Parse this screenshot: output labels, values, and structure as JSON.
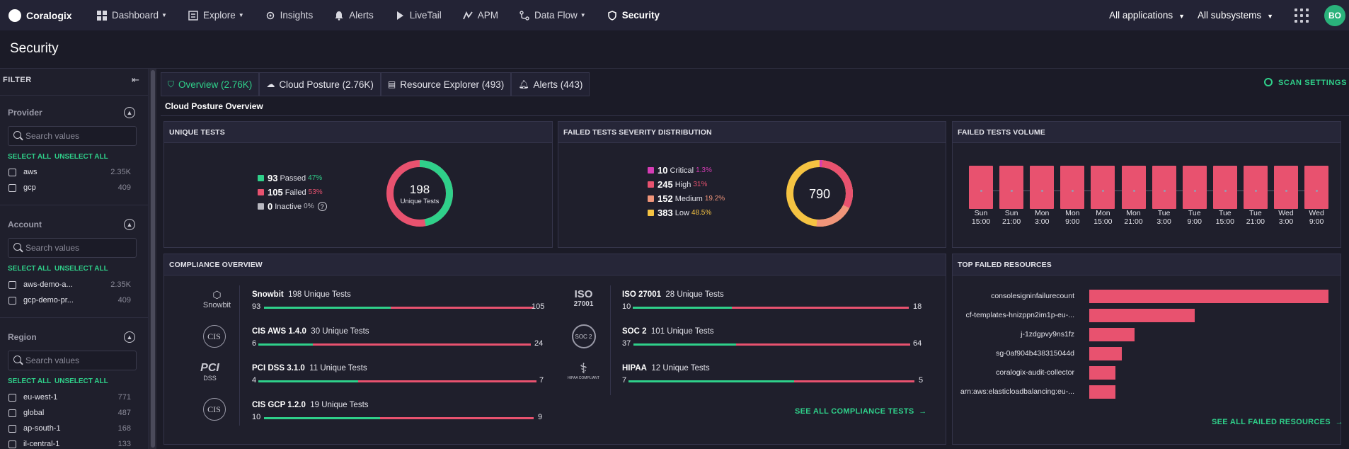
{
  "topnav": {
    "logo_text": "Coralogix",
    "items": [
      {
        "label": "Dashboard",
        "icon": "dashboard-icon",
        "dropdown": true
      },
      {
        "label": "Explore",
        "icon": "explore-icon",
        "dropdown": true
      },
      {
        "label": "Insights",
        "icon": "insights-icon",
        "dropdown": false
      },
      {
        "label": "Alerts",
        "icon": "bell-icon",
        "dropdown": false
      },
      {
        "label": "LiveTail",
        "icon": "play-icon",
        "dropdown": false
      },
      {
        "label": "APM",
        "icon": "apm-icon",
        "dropdown": false
      },
      {
        "label": "Data Flow",
        "icon": "data-flow-icon",
        "dropdown": true
      },
      {
        "label": "Security",
        "icon": "shield-icon",
        "dropdown": false,
        "active": true
      }
    ],
    "apps_select": "All applications",
    "subsystems_select": "All subsystems",
    "avatar": "BO"
  },
  "page_title": "Security",
  "sidebar": {
    "filter_label": "FILTER",
    "select_all": "SELECT ALL",
    "unselect_all": "UNSELECT ALL",
    "search_placeholder": "Search values",
    "sections": [
      {
        "title": "Provider",
        "rows": [
          {
            "label": "aws",
            "count": "2.35K"
          },
          {
            "label": "gcp",
            "count": "409"
          }
        ]
      },
      {
        "title": "Account",
        "rows": [
          {
            "label": "aws-demo-a...",
            "count": "2.35K"
          },
          {
            "label": "gcp-demo-pr...",
            "count": "409"
          }
        ]
      },
      {
        "title": "Region",
        "rows": [
          {
            "label": "eu-west-1",
            "count": "771"
          },
          {
            "label": "global",
            "count": "487"
          },
          {
            "label": "ap-south-1",
            "count": "168"
          },
          {
            "label": "il-central-1",
            "count": "133"
          }
        ]
      }
    ]
  },
  "tabs": [
    {
      "label": "Overview (2.76K)",
      "icon": "shield-icon",
      "active": true
    },
    {
      "label": "Cloud Posture (2.76K)",
      "icon": "cloud-icon"
    },
    {
      "label": "Resource Explorer (493)",
      "icon": "server-icon"
    },
    {
      "label": "Alerts (443)",
      "icon": "bell-icon"
    }
  ],
  "scan_settings": "SCAN SETTINGS",
  "section_title": "Cloud Posture Overview",
  "unique_tests": {
    "title": "UNIQUE TESTS",
    "center_value": "198",
    "center_label": "Unique Tests",
    "legend": [
      {
        "value": "93",
        "label": "Passed",
        "pct": "47%",
        "color": "#2fd08a"
      },
      {
        "value": "105",
        "label": "Failed",
        "pct": "53%",
        "color": "#e8526f"
      },
      {
        "value": "0",
        "label": "Inactive",
        "pct": "0%",
        "color": "#b8b8c0"
      }
    ]
  },
  "severity": {
    "title": "FAILED TESTS SEVERITY DISTRIBUTION",
    "center_value": "790",
    "legend": [
      {
        "value": "10",
        "label": "Critical",
        "pct": "1.3%",
        "color": "#d63cb5"
      },
      {
        "value": "245",
        "label": "High",
        "pct": "31%",
        "color": "#e8526f"
      },
      {
        "value": "152",
        "label": "Medium",
        "pct": "19.2%",
        "color": "#f0957a"
      },
      {
        "value": "383",
        "label": "Low",
        "pct": "48.5%",
        "color": "#f5c342"
      }
    ]
  },
  "volume": {
    "title": "FAILED TESTS VOLUME",
    "labels": [
      [
        "Sun",
        "15:00"
      ],
      [
        "Sun",
        "21:00"
      ],
      [
        "Mon",
        "3:00"
      ],
      [
        "Mon",
        "9:00"
      ],
      [
        "Mon",
        "15:00"
      ],
      [
        "Mon",
        "21:00"
      ],
      [
        "Tue",
        "3:00"
      ],
      [
        "Tue",
        "9:00"
      ],
      [
        "Tue",
        "15:00"
      ],
      [
        "Tue",
        "21:00"
      ],
      [
        "Wed",
        "3:00"
      ],
      [
        "Wed",
        "9:00"
      ]
    ]
  },
  "compliance": {
    "title": "COMPLIANCE OVERVIEW",
    "see_all": "SEE ALL COMPLIANCE TESTS",
    "items": [
      {
        "name": "Snowbit",
        "tests": "198 Unique Tests",
        "passed": "93",
        "failed": "105",
        "icon": "Snowbit",
        "icon_name": "snowbit-icon"
      },
      {
        "name": "CIS AWS 1.4.0",
        "tests": "30 Unique Tests",
        "passed": "6",
        "failed": "24",
        "icon": "CIS",
        "icon_name": "cis-icon"
      },
      {
        "name": "PCI DSS 3.1.0",
        "tests": "11 Unique Tests",
        "passed": "4",
        "failed": "7",
        "icon": "PCI DSS",
        "icon_name": "pci-dss-icon"
      },
      {
        "name": "CIS GCP 1.2.0",
        "tests": "19 Unique Tests",
        "passed": "10",
        "failed": "9",
        "icon": "CIS",
        "icon_name": "cis-icon"
      },
      {
        "name": "ISO 27001",
        "tests": "28 Unique Tests",
        "passed": "10",
        "failed": "18",
        "icon": "ISO 27001",
        "icon_name": "iso-icon"
      },
      {
        "name": "SOC 2",
        "tests": "101 Unique Tests",
        "passed": "37",
        "failed": "64",
        "icon": "SOC 2",
        "icon_name": "soc2-icon"
      },
      {
        "name": "HIPAA",
        "tests": "12 Unique Tests",
        "passed": "7",
        "failed": "5",
        "icon": "HIPAA COMPLIANT",
        "icon_name": "hipaa-icon"
      }
    ]
  },
  "top_failed": {
    "title": "TOP FAILED RESOURCES",
    "see_all": "SEE ALL FAILED RESOURCES",
    "items": [
      {
        "label": "consolesigninfailurecount",
        "value": 1.0
      },
      {
        "label": "cf-templates-hnizppn2im1p-eu-...",
        "value": 0.44
      },
      {
        "label": "j-1zdgpvy9ns1fz",
        "value": 0.19
      },
      {
        "label": "sg-0af904b438315044d",
        "value": 0.135
      },
      {
        "label": "coralogix-audit-collector",
        "value": 0.108
      },
      {
        "label": "arn:aws:elasticloadbalancing:eu-...",
        "value": 0.108
      }
    ]
  }
}
